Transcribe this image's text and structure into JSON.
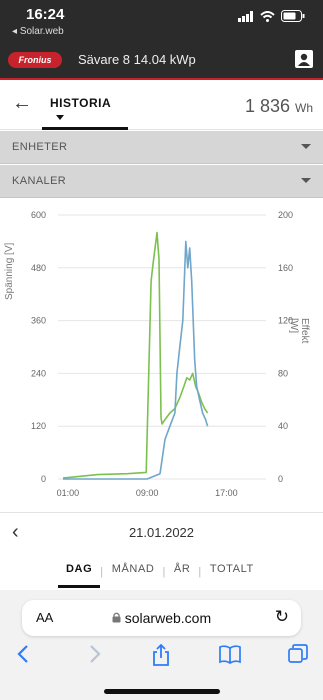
{
  "status": {
    "time": "16:24",
    "back_app": "Solar.web"
  },
  "app": {
    "brand": "Fronius",
    "title": "Sävare 8 14.04 kWp"
  },
  "history": {
    "tab_label": "HISTORIA",
    "value": "1 836",
    "unit": "Wh"
  },
  "dropdowns": {
    "devices": "ENHETER",
    "channels": "KANALER"
  },
  "chart_data": {
    "type": "line",
    "xlabel": "",
    "x_tick_labels": [
      "01:00",
      "09:00",
      "17:00"
    ],
    "ylabel_left": "Spänning [V]",
    "ylabel_right": "Effekt [W]",
    "y_left_ticks": [
      "0",
      "120",
      "240",
      "360",
      "480",
      "600"
    ],
    "y_right_ticks": [
      "0",
      "40",
      "80",
      "120",
      "160",
      "200"
    ],
    "ylim_left": [
      0,
      600
    ],
    "ylim_right": [
      0,
      200
    ],
    "grid": true,
    "series": [
      {
        "axis": "left",
        "color": "#7cc04f",
        "x_hours": [
          0.5,
          4,
          7,
          8.9,
          9.4,
          9.6,
          10.0,
          10.2,
          10.4,
          10.5,
          10.8,
          11.3,
          11.8,
          12.3,
          12.7,
          13.0,
          13.3,
          13.6,
          13.9,
          14.2,
          14.5,
          14.8,
          15.1
        ],
        "values": [
          2,
          10,
          12,
          15,
          450,
          490,
          560,
          500,
          140,
          125,
          135,
          150,
          160,
          185,
          210,
          230,
          225,
          240,
          210,
          195,
          175,
          160,
          150
        ]
      },
      {
        "axis": "right",
        "color": "#6fa6c9",
        "x_hours": [
          0.5,
          9.0,
          10.3,
          10.8,
          11.3,
          11.8,
          12.0,
          12.3,
          12.6,
          12.9,
          13.1,
          13.3,
          13.5,
          13.8,
          14.0,
          14.3,
          14.6,
          14.9,
          15.1
        ],
        "values": [
          0,
          0,
          4,
          30,
          40,
          50,
          80,
          100,
          120,
          180,
          160,
          175,
          150,
          90,
          70,
          60,
          50,
          45,
          40
        ]
      }
    ]
  },
  "date_nav": {
    "date": "21.01.2022"
  },
  "period_tabs": [
    "DAG",
    "MÅNAD",
    "ÅR",
    "TOTALT"
  ],
  "browser": {
    "aa": "AA",
    "url": "solarweb.com"
  },
  "colors": {
    "accent": "#c8232c",
    "header_bg": "#2b2b2b",
    "safari_blue": "#2f7df6"
  }
}
